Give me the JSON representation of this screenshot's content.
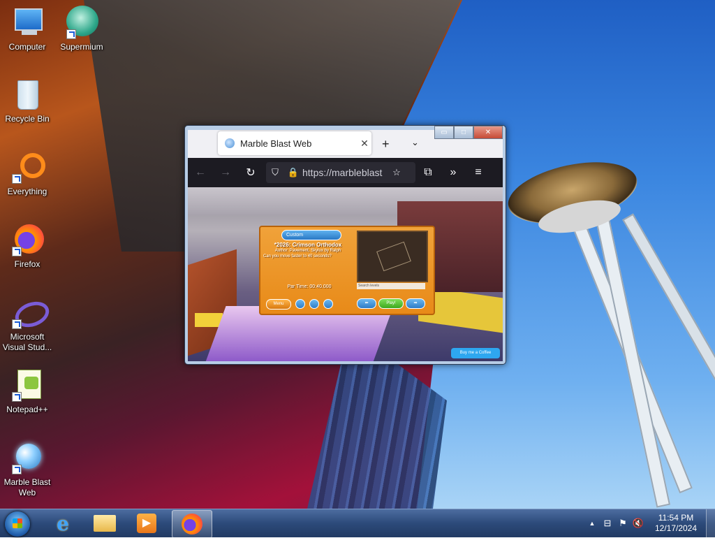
{
  "desktop": {
    "icons": [
      {
        "label": "Computer",
        "icon": "computer-icon"
      },
      {
        "label": "Supermium",
        "icon": "supermium-icon"
      },
      {
        "label": "Recycle Bin",
        "icon": "recycle-bin-icon"
      },
      {
        "label": "Everything",
        "icon": "everything-icon"
      },
      {
        "label": "Firefox",
        "icon": "firefox-icon"
      },
      {
        "label": "Microsoft Visual Stud...",
        "icon": "visual-studio-icon"
      },
      {
        "label": "Notepad++",
        "icon": "notepadpp-icon"
      },
      {
        "label": "Marble Blast Web",
        "icon": "marble-blast-icon"
      }
    ]
  },
  "browser": {
    "tab_title": "Marble Blast Web",
    "tab_close": "✕",
    "new_tab": "+",
    "tab_list": "⌄",
    "url": "https://marbleblast",
    "window_controls": {
      "minimize": "▭",
      "maximize": "□",
      "close": "✕"
    },
    "nav": {
      "back": "←",
      "forward": "→",
      "reload": "↻",
      "shield": "⛉",
      "lock": "🔒",
      "star": "☆",
      "extensions": "⧉",
      "overflow": "»",
      "menu": "≡"
    }
  },
  "game": {
    "category": "Custom",
    "level_title": "*2026: Crimson Orthodox",
    "author": "Author: Pavement, Skylux by Ralph",
    "description": "Can you move faster to 40 seconds?",
    "par_time": "Par Time: 00:40.000",
    "search_placeholder": "Search levels",
    "menu_button": "Menu",
    "prev_button": "⬅",
    "play_button": "Play!",
    "next_button": "➡",
    "coffee_button": "Buy me a Coffee"
  },
  "taskbar": {
    "pinned": [
      {
        "name": "internet-explorer",
        "glyph": "e"
      },
      {
        "name": "file-explorer",
        "glyph": "▤"
      },
      {
        "name": "media-player",
        "glyph": "▶"
      },
      {
        "name": "firefox",
        "glyph": "●"
      }
    ],
    "tray": {
      "show_hidden": "▲",
      "network": "⊟",
      "flag": "⚑",
      "volume": "🔇"
    },
    "time": "11:54 PM",
    "date": "12/17/2024"
  },
  "colors": {
    "taskbar": "#2c4a7a",
    "browser_dark": "#1c1b22",
    "game_orange": "#e88a18",
    "play_green": "#4fc62a"
  }
}
